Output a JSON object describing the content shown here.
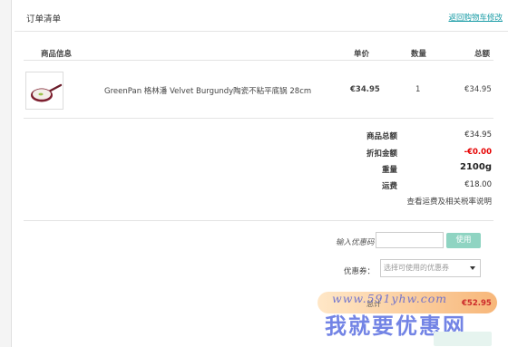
{
  "header": {
    "title": "订单清单",
    "back_link": "返回购物车修改"
  },
  "table": {
    "columns": {
      "product": "商品信息",
      "price": "单价",
      "qty": "数量",
      "total": "总额"
    },
    "rows": [
      {
        "name": "GreenPan 格林潘 Velvet Burgundy陶瓷不粘平底锅 28cm",
        "price": "€34.95",
        "qty": "1",
        "total": "€34.95"
      }
    ]
  },
  "summary": {
    "subtotal_label": "商品总额",
    "subtotal_value": "€34.95",
    "discount_label": "折扣金额",
    "discount_value": "-€0.00",
    "weight_label": "重量",
    "weight_value": "2100g",
    "shipping_label": "运费",
    "shipping_value": "€18.00",
    "tax_link": "查看运费及相关税率说明"
  },
  "coupon": {
    "code_label": "输入优惠码",
    "code_value": "",
    "apply_label": "使用",
    "select_label": "优惠券：",
    "select_value": "选择可使用的优惠券"
  },
  "total": {
    "label": "总计",
    "value": "€52.95"
  },
  "watermark": {
    "url": "www.591yhw.com",
    "text": "我就要优惠网"
  },
  "colors": {
    "link": "#1a9ca6",
    "discount": "#e60000",
    "apply_button": "#8fd4c2",
    "watermark": "#5a6ee1"
  }
}
